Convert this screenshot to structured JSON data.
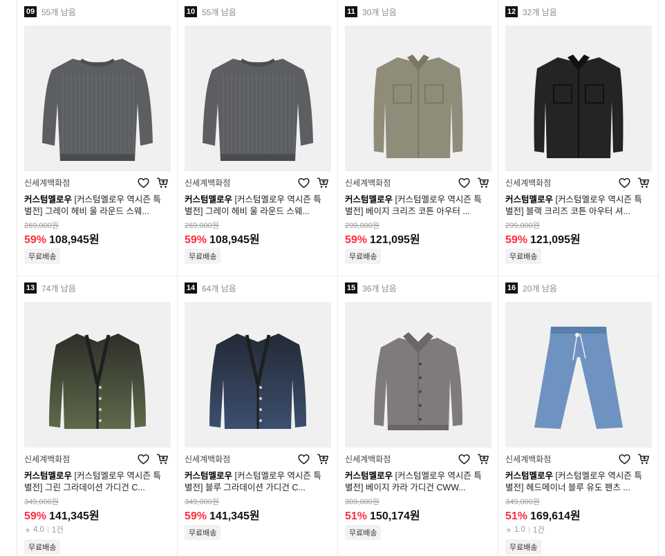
{
  "products": [
    {
      "rank": "09",
      "remaining": "55개 남음",
      "store": "신세계백화점",
      "brand": "커스텀멜로우",
      "title": " [커스텀멜로우 역시즌 특별전] 그레이 헤비 울 라운드 스웨...",
      "original_price": "269,000원",
      "discount": "59%",
      "price": "108,945원",
      "rating": "",
      "reviews": "",
      "shipping": "무료배송",
      "image": "sweater-gray",
      "color": "#5c5e62",
      "accent": "#4a4c50"
    },
    {
      "rank": "10",
      "remaining": "55개 남음",
      "store": "신세계백화점",
      "brand": "커스텀멜로우",
      "title": " [커스텀멜로우 역시즌 특별전] 그레이 헤비 울 라운드 스웨...",
      "original_price": "269,000원",
      "discount": "59%",
      "price": "108,945원",
      "rating": "",
      "reviews": "",
      "shipping": "무료배송",
      "image": "sweater-gray",
      "color": "#5c5e62",
      "accent": "#4a4c50"
    },
    {
      "rank": "11",
      "remaining": "30개 남음",
      "store": "신세계백화점",
      "brand": "커스텀멜로우",
      "title": " [커스텀멜로우 역시즌 특별전] 베이지 크리즈 코튼 아우터 ...",
      "original_price": "299,000원",
      "discount": "59%",
      "price": "121,095원",
      "rating": "",
      "reviews": "",
      "shipping": "무료배송",
      "image": "shirt-jacket",
      "color": "#8f8c79",
      "accent": "#7a7765"
    },
    {
      "rank": "12",
      "remaining": "32개 남음",
      "store": "신세계백화점",
      "brand": "커스텀멜로우",
      "title": " [커스텀멜로우 역시즌 특별전] 블랙 크리즈 코튼 아우터 셔...",
      "original_price": "299,000원",
      "discount": "59%",
      "price": "121,095원",
      "rating": "",
      "reviews": "",
      "shipping": "무료배송",
      "image": "shirt-jacket",
      "color": "#242424",
      "accent": "#111111"
    },
    {
      "rank": "13",
      "remaining": "74개 남음",
      "store": "신세계백화점",
      "brand": "커스텀멜로우",
      "title": " [커스텀멜로우 역시즌 특별전] 그린 그라데이션 가디건 C...",
      "original_price": "349,000원",
      "discount": "59%",
      "price": "141,345원",
      "rating": "4.0",
      "reviews": "1건",
      "shipping": "무료배송",
      "image": "cardigan",
      "color": "#5f6a4a",
      "accent": "#2e2f2a"
    },
    {
      "rank": "14",
      "remaining": "64개 남음",
      "store": "신세계백화점",
      "brand": "커스텀멜로우",
      "title": " [커스텀멜로우 역시즌 특별전] 블루 그라데이션 가디건 C...",
      "original_price": "349,000원",
      "discount": "59%",
      "price": "141,345원",
      "rating": "",
      "reviews": "",
      "shipping": "무료배송",
      "image": "cardigan",
      "color": "#3c4f6e",
      "accent": "#242a36"
    },
    {
      "rank": "15",
      "remaining": "36개 남음",
      "store": "신세계백화점",
      "brand": "커스텀멜로우",
      "title": " [커스텀멜로우 역시즌 특별전] 베이지 카라 가디건 CWW...",
      "original_price": "309,000원",
      "discount": "51%",
      "price": "150,174원",
      "rating": "",
      "reviews": "",
      "shipping": "무료배송",
      "image": "collar-cardigan",
      "color": "#807b7b",
      "accent": "#6c6767"
    },
    {
      "rank": "16",
      "remaining": "20개 남음",
      "store": "신세계백화점",
      "brand": "커스텀멜로우",
      "title": " [커스텀멜로우 역시즌 특별전] 헤드메이너 블루 유도 팬츠 ...",
      "original_price": "349,000원",
      "discount": "51%",
      "price": "169,614원",
      "rating": "1.0",
      "reviews": "1건",
      "shipping": "무료배송",
      "image": "pants",
      "color": "#6f93c0",
      "accent": "#5b7fad"
    }
  ]
}
